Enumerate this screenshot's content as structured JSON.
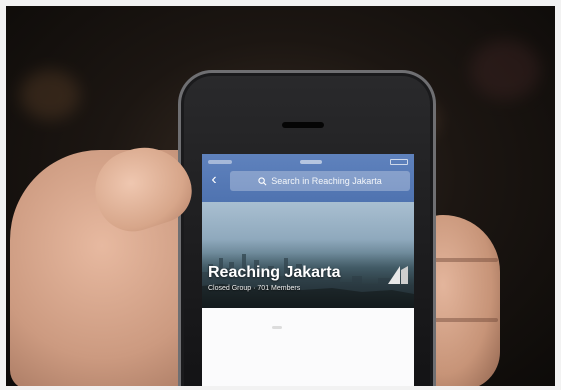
{
  "screen": {
    "search": {
      "label": "Search in Reaching Jakarta"
    },
    "group": {
      "title": "Reaching Jakarta",
      "subtitle": "Closed Group · 701 Members"
    },
    "icons": {
      "back": "back-arrow-icon",
      "search": "search-icon",
      "logo": "group-logo-icon"
    },
    "colors": {
      "navbar": "#5a7fbc",
      "title_text": "#ffffff"
    }
  }
}
